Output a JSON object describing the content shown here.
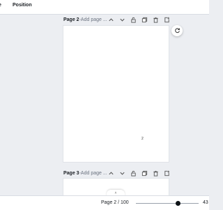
{
  "toolbar": {
    "items": [
      {
        "label": "e"
      },
      {
        "label": "Position"
      }
    ]
  },
  "pages": [
    {
      "title": "Page 2",
      "separator": " - ",
      "subtitle": "Add page ...",
      "page_number_text": "2",
      "icons": [
        "chevron-up-icon",
        "chevron-down-icon",
        "lock-icon",
        "duplicate-icon",
        "trash-icon",
        "add-page-icon"
      ]
    },
    {
      "title": "Page 3",
      "separator": " - ",
      "subtitle": "Add page ...",
      "icons": [
        "chevron-up-icon",
        "chevron-down-icon",
        "lock-icon",
        "duplicate-icon",
        "trash-icon",
        "add-page-icon"
      ]
    }
  ],
  "refresh_button": {
    "icon": "refresh-icon"
  },
  "scroll_handle": {
    "icon": "chevron-up-icon"
  },
  "footer": {
    "page_indicator": "Page 2 / 100",
    "zoom_label": "43",
    "zoom_fraction": 0.67
  }
}
